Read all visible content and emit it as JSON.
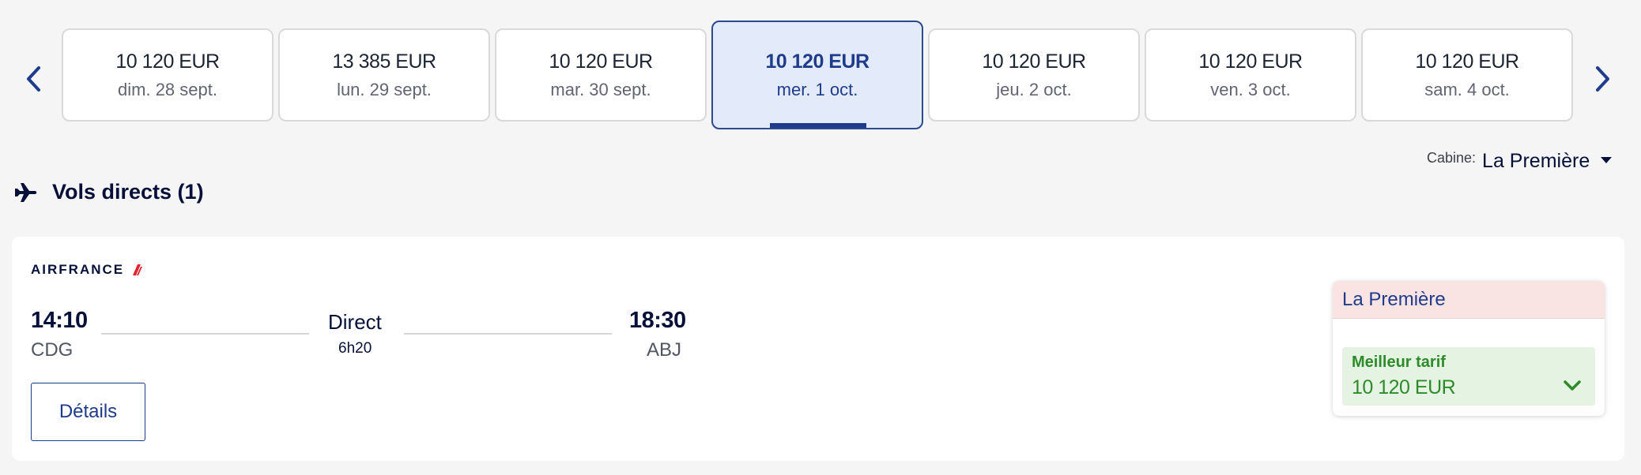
{
  "nav": {
    "prev_icon": "chevron-left-icon",
    "next_icon": "chevron-right-icon"
  },
  "dates": [
    {
      "price": "10 120 EUR",
      "date": "dim. 28 sept.",
      "selected": false
    },
    {
      "price": "13 385 EUR",
      "date": "lun. 29 sept.",
      "selected": false
    },
    {
      "price": "10 120 EUR",
      "date": "mar. 30 sept.",
      "selected": false
    },
    {
      "price": "10 120 EUR",
      "date": "mer. 1 oct.",
      "selected": true
    },
    {
      "price": "10 120 EUR",
      "date": "jeu. 2 oct.",
      "selected": false
    },
    {
      "price": "10 120 EUR",
      "date": "ven. 3 oct.",
      "selected": false
    },
    {
      "price": "10 120 EUR",
      "date": "sam. 4 oct.",
      "selected": false
    }
  ],
  "cabin": {
    "label": "Cabine:",
    "value": "La Première"
  },
  "section": {
    "title": "Vols directs (1)",
    "icon": "plane-icon"
  },
  "flight": {
    "airline": "AIRFRANCE",
    "departure_time": "14:10",
    "departure_airport": "CDG",
    "stops": "Direct",
    "duration": "6h20",
    "arrival_time": "18:30",
    "arrival_airport": "ABJ",
    "details_label": "Détails"
  },
  "fare": {
    "cabin_name": "La Première",
    "option_label": "Meilleur tarif",
    "option_price": "10 120 EUR"
  },
  "colors": {
    "accent": "#1e3b8c",
    "selected_bg": "#e3ebfa",
    "fare_header_bg": "#f9e3e3",
    "best_fare_bg": "#e5f3e3",
    "best_fare_text": "#2e8b2a",
    "logo_red": "#e4222e"
  }
}
